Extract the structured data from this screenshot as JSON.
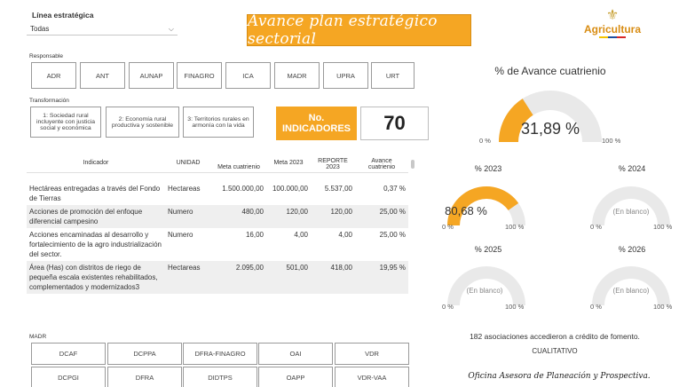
{
  "linea": {
    "label": "Línea estratégica",
    "selected": "Todas"
  },
  "responsable": {
    "label": "Responsable",
    "buttons": [
      "ADR",
      "ANT",
      "AUNAP",
      "FINAGRO",
      "ICA",
      "MADR",
      "UPRA",
      "URT"
    ]
  },
  "transformacion": {
    "label": "Transformación",
    "buttons": [
      "1: Sociedad rural incluyente con justicia social y económica",
      "2: Economía rural productiva y sostenible",
      "3: Territorios rurales en armonía con la vida"
    ]
  },
  "banner": {
    "title": "Avance plan estratégico sectorial"
  },
  "logo": {
    "name": "Agricultura"
  },
  "kpi": {
    "label": "No. INDICADORES",
    "value": "70"
  },
  "table": {
    "headers": [
      "Indicador",
      "UNIDAD",
      "Meta cuatrienio",
      "Meta 2023",
      "REPORTE 2023",
      "Avance cuatrienio"
    ],
    "rows": [
      [
        "Hectáreas entregadas a través del Fondo de Tierras",
        "Hectareas",
        "1.500.000,00",
        "100.000,00",
        "5.537,00",
        "0,37 %"
      ],
      [
        "Acciones de promoción del enfoque diferencial campesino",
        "Numero",
        "480,00",
        "120,00",
        "120,00",
        "25,00 %"
      ],
      [
        "Acciones encaminadas al desarrollo y fortalecimiento de la agro industrialización del sector.",
        "Numero",
        "16,00",
        "4,00",
        "4,00",
        "25,00 %"
      ],
      [
        "Área (Has) con distritos de riego de pequeña escala existentes rehabilitados, complementados y modernizados3",
        "Hectareas",
        "2.095,00",
        "501,00",
        "418,00",
        "19,95 %"
      ]
    ]
  },
  "madr": {
    "label": "MADR",
    "buttons_row1": [
      "DCAF",
      "DCPPA",
      "DFRA-FINAGRO",
      "OAI",
      "VDR"
    ],
    "buttons_row2": [
      "DCPGI",
      "DFRA",
      "DIDTPS",
      "OAPP",
      "VDR-VAA"
    ]
  },
  "gauges": {
    "main": {
      "title": "% de Avance cuatrienio",
      "value_text": "31,89 %",
      "fraction": 0.3189,
      "min": "0 %",
      "max": "100 %"
    },
    "g2023": {
      "title": "% 2023",
      "value_text": "80,68 %",
      "fraction": 0.8068,
      "min": "0 %",
      "max": "100 %"
    },
    "g2024": {
      "title": "% 2024",
      "value_text": "(En blanco)",
      "fraction": 0,
      "min": "0 %",
      "max": "100 %"
    },
    "g2025": {
      "title": "% 2025",
      "value_text": "(En blanco)",
      "fraction": 0,
      "min": "0 %",
      "max": "100 %"
    },
    "g2026": {
      "title": "% 2026",
      "value_text": "(En blanco)",
      "fraction": 0,
      "min": "0 %",
      "max": "100 %"
    }
  },
  "credito": {
    "text": "182 asociaciones accedieron a crédito de fomento.",
    "subtext": "CUALITATIVO"
  },
  "footer": {
    "text": "Oficina Asesora de Planeación y Prospectiva."
  },
  "colors": {
    "accent": "#f5a623",
    "gauge_bg": "#e9e9e9"
  }
}
